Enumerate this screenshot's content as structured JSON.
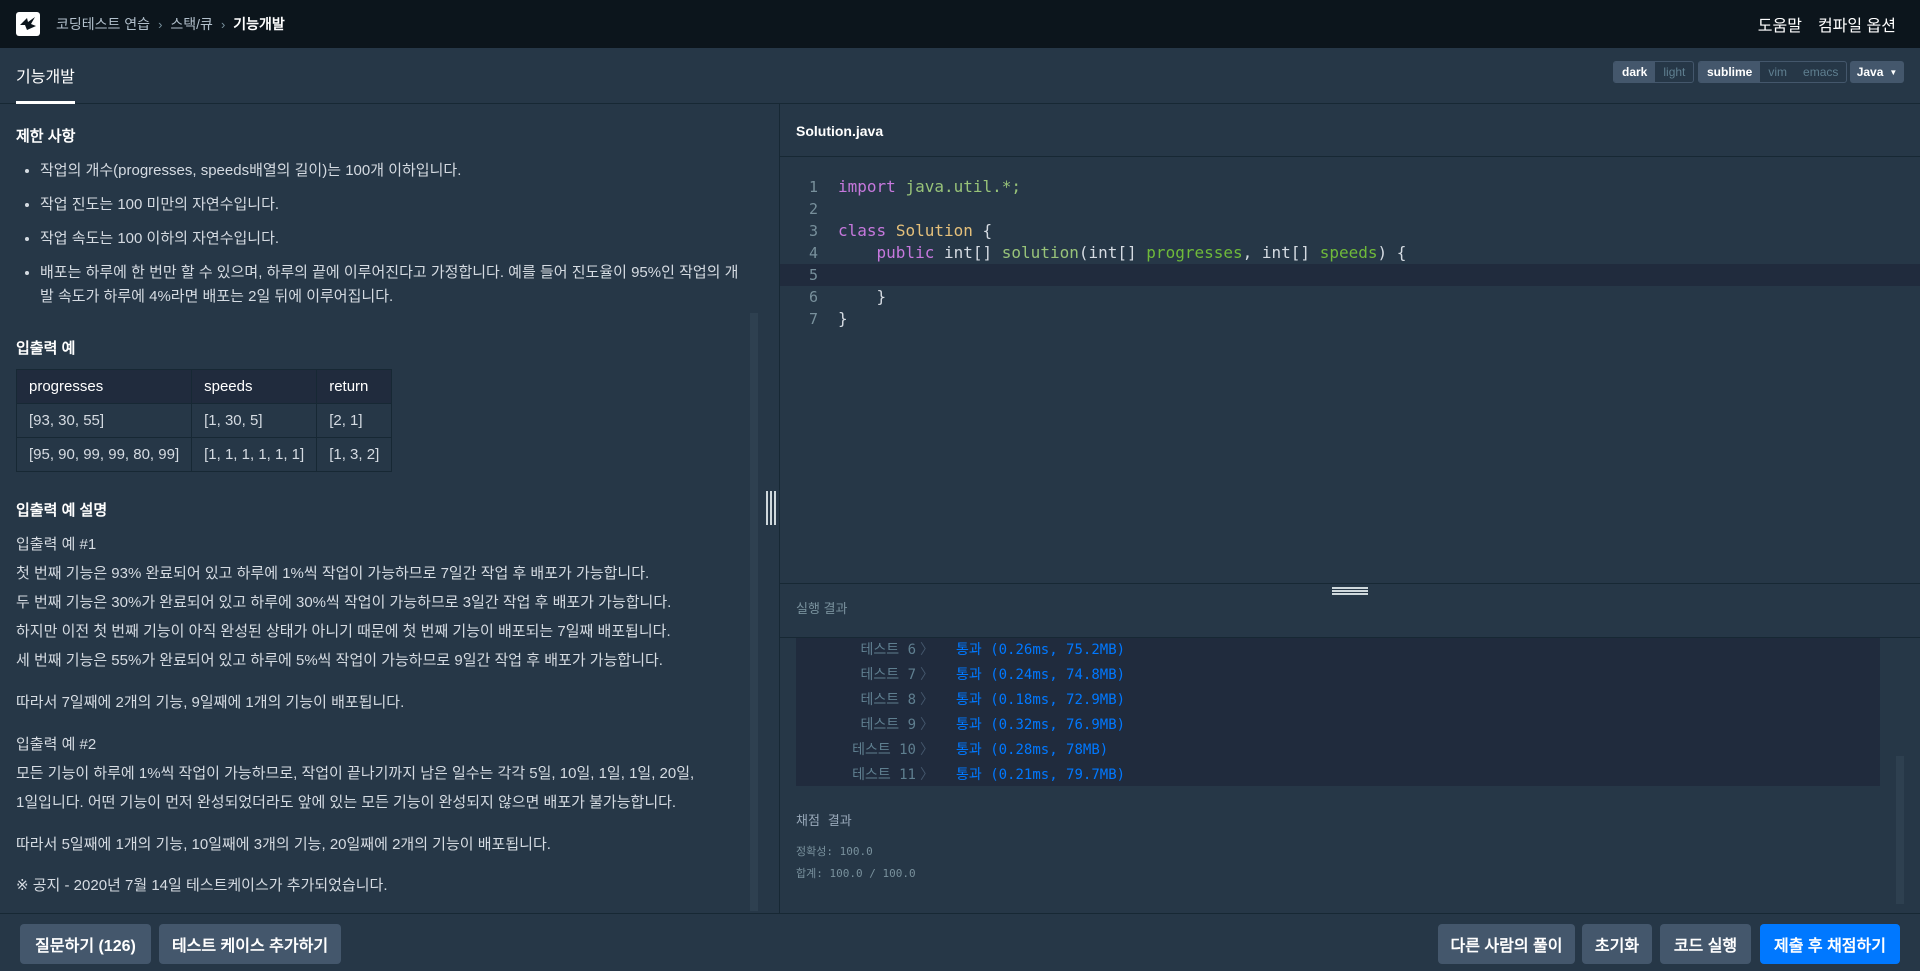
{
  "breadcrumb": {
    "items": [
      "코딩테스트 연습",
      "스택/큐"
    ],
    "current": "기능개발"
  },
  "topright": {
    "help": "도움말",
    "compile_options": "컴파일 옵션"
  },
  "subheader": {
    "title": "기능개발"
  },
  "theme": {
    "dark": "dark",
    "light": "light"
  },
  "keymap": {
    "sublime": "sublime",
    "vim": "vim",
    "emacs": "emacs"
  },
  "language": {
    "selected": "Java"
  },
  "problem": {
    "constraints_title": "제한 사항",
    "constraints": [
      "작업의 개수(progresses, speeds배열의 길이)는 100개 이하입니다.",
      "작업 진도는 100 미만의 자연수입니다.",
      "작업 속도는 100 이하의 자연수입니다.",
      "배포는 하루에 한 번만 할 수 있으며, 하루의 끝에 이루어진다고 가정합니다. 예를 들어 진도율이 95%인 작업의 개발 속도가 하루에 4%라면 배포는 2일 뒤에 이루어집니다."
    ],
    "io_title": "입출력 예",
    "io_table": {
      "headers": [
        "progresses",
        "speeds",
        "return"
      ],
      "rows": [
        [
          "[93, 30, 55]",
          "[1, 30, 5]",
          "[2, 1]"
        ],
        [
          "[95, 90, 99, 99, 80, 99]",
          "[1, 1, 1, 1, 1, 1]",
          "[1, 3, 2]"
        ]
      ]
    },
    "explain_title": "입출력 예 설명",
    "ex1_title": "입출력 예 #1",
    "ex1_lines": [
      "첫 번째 기능은 93% 완료되어 있고 하루에 1%씩 작업이 가능하므로 7일간 작업 후 배포가 가능합니다.",
      "두 번째 기능은 30%가 완료되어 있고 하루에 30%씩 작업이 가능하므로 3일간 작업 후 배포가 가능합니다.",
      "하지만 이전 첫 번째 기능이 아직 완성된 상태가 아니기 때문에 첫 번째 기능이 배포되는 7일째 배포됩니다.",
      "세 번째 기능은 55%가 완료되어 있고 하루에 5%씩 작업이 가능하므로 9일간 작업 후 배포가 가능합니다."
    ],
    "ex1_summary": "따라서 7일째에 2개의 기능, 9일째에 1개의 기능이 배포됩니다.",
    "ex2_title": "입출력 예 #2",
    "ex2_lines": [
      "모든 기능이 하루에 1%씩 작업이 가능하므로, 작업이 끝나기까지 남은 일수는 각각 5일, 10일, 1일, 1일, 20일,",
      "1일입니다. 어떤 기능이 먼저 완성되었더라도 앞에 있는 모든 기능이 완성되지 않으면 배포가 불가능합니다."
    ],
    "ex2_summary": "따라서 5일째에 1개의 기능, 10일째에 3개의 기능, 20일째에 2개의 기능이 배포됩니다.",
    "notice": "※ 공지 - 2020년 7월 14일 테스트케이스가 추가되었습니다."
  },
  "editor": {
    "filename": "Solution.java",
    "line_numbers": [
      "1",
      "2",
      "3",
      "4",
      "5",
      "6",
      "7"
    ],
    "l1": {
      "kw": "import",
      "pkg": "java.util.*;"
    },
    "l3": {
      "kw": "class",
      "cls": "Solution",
      "brace": "{"
    },
    "l4": {
      "kw": "public",
      "type1": "int[]",
      "fn": "solution",
      "t2": "int[]",
      "p1": "progresses",
      "t3": "int[]",
      "p2": "speeds",
      "end": ") {"
    },
    "l6": "}",
    "l7": "}"
  },
  "result": {
    "title": "실행 결과",
    "tests": [
      {
        "name": "테스트 6",
        "value": "통과 (0.26ms, 75.2MB)"
      },
      {
        "name": "테스트 7",
        "value": "통과 (0.24ms, 74.8MB)"
      },
      {
        "name": "테스트 8",
        "value": "통과 (0.18ms, 72.9MB)"
      },
      {
        "name": "테스트 9",
        "value": "통과 (0.32ms, 76.9MB)"
      },
      {
        "name": "테스트 10",
        "value": "통과 (0.28ms, 78MB)"
      },
      {
        "name": "테스트 11",
        "value": "통과 (0.21ms, 79.7MB)"
      }
    ],
    "grade_title": "채점 결과",
    "accuracy": "정확성: 100.0",
    "total": "합계: 100.0 / 100.0"
  },
  "buttons": {
    "ask": "질문하기 (126)",
    "add_testcase": "테스트 케이스 추가하기",
    "others": "다른 사람의 풀이",
    "reset": "초기화",
    "run": "코드 실행",
    "submit": "제출 후 채점하기"
  },
  "colors": {
    "accent": "#0078ff",
    "background": "#263747",
    "topbar": "#0c151c"
  }
}
